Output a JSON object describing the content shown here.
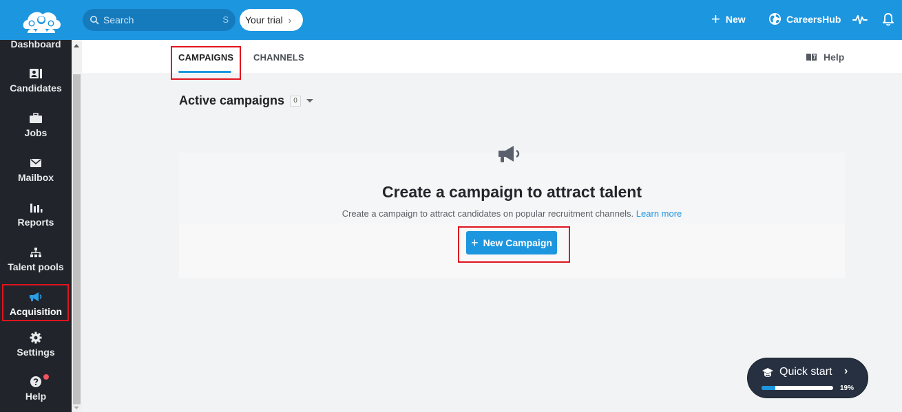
{
  "topbar": {
    "logo_icon": "team-cloud-logo",
    "search_placeholder": "Search",
    "search_shortcut": "S",
    "trial_label": "Your trial",
    "trial_chevron": "›",
    "new_label": "New",
    "careershub_label": "CareersHub",
    "activity_icon": "activity-pulse-icon",
    "notifications_icon": "bell-icon"
  },
  "sidebar": {
    "items": [
      {
        "label": "Dashboard",
        "icon": "dashboard-icon"
      },
      {
        "label": "Candidates",
        "icon": "id-card-icon"
      },
      {
        "label": "Jobs",
        "icon": "briefcase-icon"
      },
      {
        "label": "Mailbox",
        "icon": "envelope-icon"
      },
      {
        "label": "Reports",
        "icon": "bar-chart-icon"
      },
      {
        "label": "Talent pools",
        "icon": "hierarchy-icon"
      },
      {
        "label": "Acquisition",
        "icon": "megaphone-icon",
        "active": true
      },
      {
        "label": "Settings",
        "icon": "gear-icon"
      },
      {
        "label": "Help",
        "icon": "question-circle-icon",
        "has_notification": true
      }
    ]
  },
  "tabs": {
    "items": [
      {
        "label": "CAMPAIGNS",
        "active": true
      },
      {
        "label": "CHANNELS",
        "active": false
      }
    ],
    "help_label": "Help"
  },
  "main": {
    "section_title": "Active campaigns",
    "count": "0",
    "empty_state": {
      "title": "Create a campaign to attract talent",
      "description": "Create a campaign to attract candidates on popular recruitment channels.",
      "learn_more": "Learn more",
      "button_label": "New Campaign"
    }
  },
  "quick_start": {
    "label": "Quick start",
    "progress_percent": 19,
    "progress_text": "19%"
  },
  "colors": {
    "brand": "#1d96e0",
    "sidebar_bg": "#21242b",
    "highlight": "#e0141e"
  }
}
